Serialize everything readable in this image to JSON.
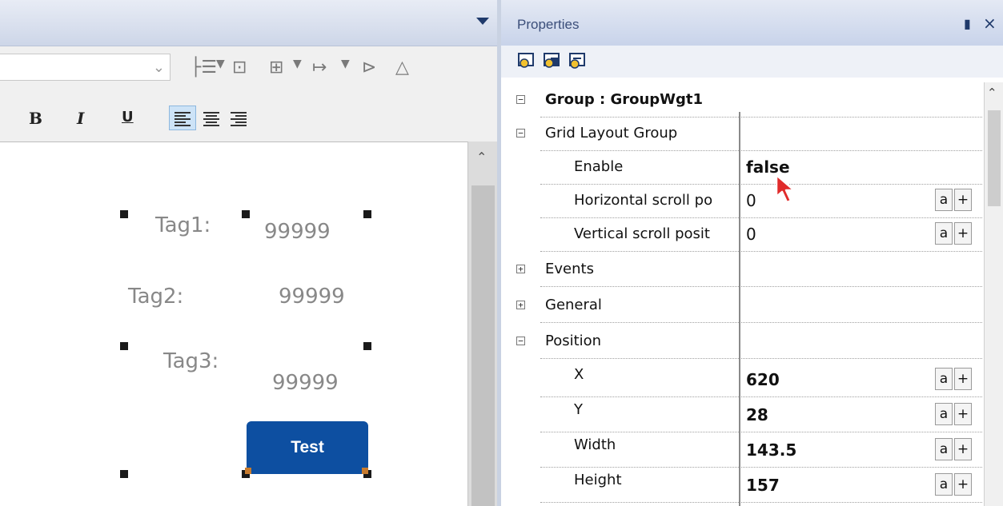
{
  "editor": {
    "tags": [
      {
        "label": "Tag1:",
        "value": "99999"
      },
      {
        "label": "Tag2:",
        "value": "99999"
      },
      {
        "label": "Tag3:",
        "value": "99999"
      }
    ],
    "button_label": "Test",
    "formatting": {
      "bold": "B",
      "italic": "I",
      "underline": "U"
    }
  },
  "properties": {
    "title": "Properties",
    "pin_glyph": "Ԩ",
    "close_glyph": "×",
    "rows": [
      {
        "name": "Group : GroupWgt1",
        "expander": "−",
        "bold": true,
        "level": 0,
        "value": ""
      },
      {
        "name": "Grid Layout Group",
        "expander": "−",
        "level": 0,
        "value": ""
      },
      {
        "name": "Enable",
        "level": 1,
        "value": "false",
        "value_bold": true
      },
      {
        "name": "Horizontal scroll po",
        "level": 1,
        "value": "0",
        "buttons": true
      },
      {
        "name": "Vertical scroll posit",
        "level": 1,
        "value": "0",
        "buttons": true
      },
      {
        "name": "Events",
        "expander": "+",
        "level": 0,
        "value": ""
      },
      {
        "name": "General",
        "expander": "+",
        "level": 0,
        "value": ""
      },
      {
        "name": "Position",
        "expander": "−",
        "level": 0,
        "value": ""
      },
      {
        "name": "X",
        "level": 1,
        "value": "620",
        "value_bold": true,
        "buttons": true
      },
      {
        "name": "Y",
        "level": 1,
        "value": "28",
        "value_bold": true,
        "buttons": true
      },
      {
        "name": "Width",
        "level": 1,
        "value": "143.5",
        "value_bold": true,
        "buttons": true
      },
      {
        "name": "Height",
        "level": 1,
        "value": "157",
        "value_bold": true,
        "buttons": true
      }
    ],
    "btn_a": "a",
    "btn_plus": "+"
  },
  "colors": {
    "accent": "#0d4fa1",
    "header": "#c8d3ea"
  }
}
